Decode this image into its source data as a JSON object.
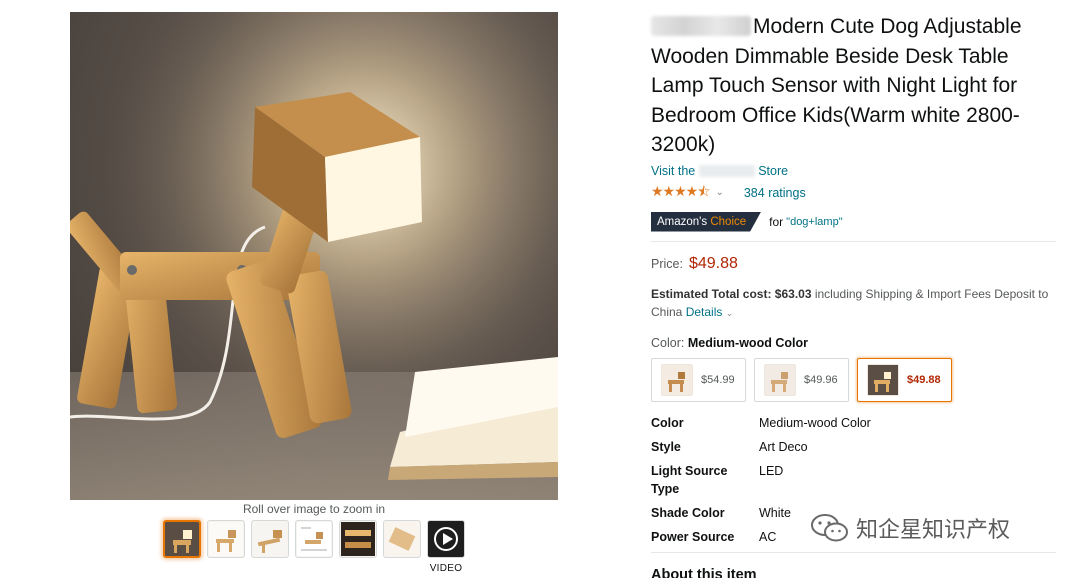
{
  "gallery": {
    "zoom_hint": "Roll over image to zoom in",
    "thumbnails": [
      {
        "name": "thumb-dog-lamp-front",
        "selected": true
      },
      {
        "name": "thumb-dog-lamp-white-1"
      },
      {
        "name": "thumb-dog-lamp-pose"
      },
      {
        "name": "thumb-dog-lamp-diagram"
      },
      {
        "name": "thumb-dog-lamp-dark"
      },
      {
        "name": "thumb-dog-lamp-white-2"
      },
      {
        "name": "thumb-video"
      }
    ],
    "video_label": "VIDEO"
  },
  "product": {
    "title": "Modern Cute Dog Adjustable Wooden Dimmable Beside Desk Table Lamp Touch Sensor with Night Light for Bedroom Office Kids(Warm white 2800-3200k)",
    "store_prefix": "Visit the",
    "store_suffix": "Store",
    "stars": "★★★★⯪",
    "ratings": "384 ratings",
    "choice_prefix": "Amazon's",
    "choice_word": "Choice",
    "for_text": "for",
    "for_keyword": "\"dog+lamp\""
  },
  "pricing": {
    "price_label": "Price:",
    "price": "$49.88",
    "est_label": "Estimated Total cost: $63.03",
    "est_rest": " including Shipping & Import Fees Deposit to China ",
    "details": "Details",
    "color_label": "Color: ",
    "color_value": "Medium-wood Color"
  },
  "swatches": [
    {
      "price": "$54.99",
      "selected": false
    },
    {
      "price": "$49.96",
      "selected": false
    },
    {
      "price": "$49.88",
      "selected": true
    }
  ],
  "specs": [
    {
      "key": "Color",
      "value": "Medium-wood Color"
    },
    {
      "key": "Style",
      "value": "Art Deco"
    },
    {
      "key": "Light Source Type",
      "value": "LED"
    },
    {
      "key": "Shade Color",
      "value": "White"
    },
    {
      "key": "Power Source",
      "value": "AC"
    }
  ],
  "about_heading": "About this item",
  "watermark": "知企星知识产权",
  "colors": {
    "link": "#007185",
    "price": "#b12704",
    "accent": "#e77600",
    "badge": "#232f3e"
  }
}
